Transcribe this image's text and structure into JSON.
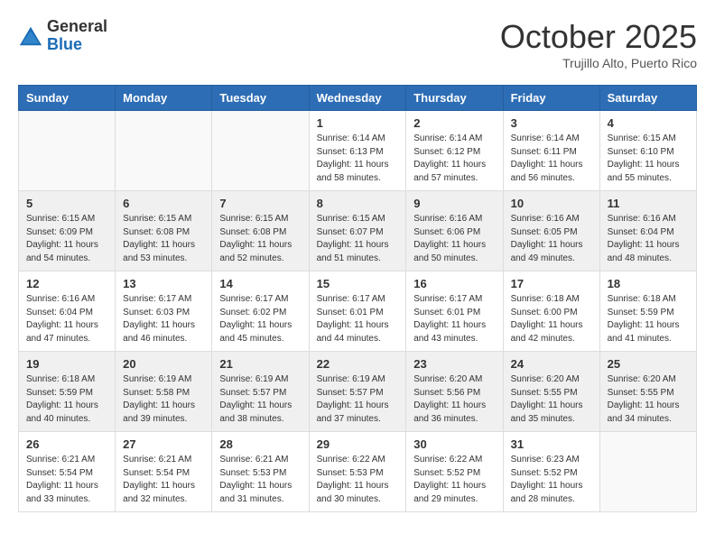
{
  "header": {
    "logo_general": "General",
    "logo_blue": "Blue",
    "month": "October 2025",
    "location": "Trujillo Alto, Puerto Rico"
  },
  "weekdays": [
    "Sunday",
    "Monday",
    "Tuesday",
    "Wednesday",
    "Thursday",
    "Friday",
    "Saturday"
  ],
  "weeks": [
    [
      {
        "day": "",
        "info": ""
      },
      {
        "day": "",
        "info": ""
      },
      {
        "day": "",
        "info": ""
      },
      {
        "day": "1",
        "info": "Sunrise: 6:14 AM\nSunset: 6:13 PM\nDaylight: 11 hours\nand 58 minutes."
      },
      {
        "day": "2",
        "info": "Sunrise: 6:14 AM\nSunset: 6:12 PM\nDaylight: 11 hours\nand 57 minutes."
      },
      {
        "day": "3",
        "info": "Sunrise: 6:14 AM\nSunset: 6:11 PM\nDaylight: 11 hours\nand 56 minutes."
      },
      {
        "day": "4",
        "info": "Sunrise: 6:15 AM\nSunset: 6:10 PM\nDaylight: 11 hours\nand 55 minutes."
      }
    ],
    [
      {
        "day": "5",
        "info": "Sunrise: 6:15 AM\nSunset: 6:09 PM\nDaylight: 11 hours\nand 54 minutes."
      },
      {
        "day": "6",
        "info": "Sunrise: 6:15 AM\nSunset: 6:08 PM\nDaylight: 11 hours\nand 53 minutes."
      },
      {
        "day": "7",
        "info": "Sunrise: 6:15 AM\nSunset: 6:08 PM\nDaylight: 11 hours\nand 52 minutes."
      },
      {
        "day": "8",
        "info": "Sunrise: 6:15 AM\nSunset: 6:07 PM\nDaylight: 11 hours\nand 51 minutes."
      },
      {
        "day": "9",
        "info": "Sunrise: 6:16 AM\nSunset: 6:06 PM\nDaylight: 11 hours\nand 50 minutes."
      },
      {
        "day": "10",
        "info": "Sunrise: 6:16 AM\nSunset: 6:05 PM\nDaylight: 11 hours\nand 49 minutes."
      },
      {
        "day": "11",
        "info": "Sunrise: 6:16 AM\nSunset: 6:04 PM\nDaylight: 11 hours\nand 48 minutes."
      }
    ],
    [
      {
        "day": "12",
        "info": "Sunrise: 6:16 AM\nSunset: 6:04 PM\nDaylight: 11 hours\nand 47 minutes."
      },
      {
        "day": "13",
        "info": "Sunrise: 6:17 AM\nSunset: 6:03 PM\nDaylight: 11 hours\nand 46 minutes."
      },
      {
        "day": "14",
        "info": "Sunrise: 6:17 AM\nSunset: 6:02 PM\nDaylight: 11 hours\nand 45 minutes."
      },
      {
        "day": "15",
        "info": "Sunrise: 6:17 AM\nSunset: 6:01 PM\nDaylight: 11 hours\nand 44 minutes."
      },
      {
        "day": "16",
        "info": "Sunrise: 6:17 AM\nSunset: 6:01 PM\nDaylight: 11 hours\nand 43 minutes."
      },
      {
        "day": "17",
        "info": "Sunrise: 6:18 AM\nSunset: 6:00 PM\nDaylight: 11 hours\nand 42 minutes."
      },
      {
        "day": "18",
        "info": "Sunrise: 6:18 AM\nSunset: 5:59 PM\nDaylight: 11 hours\nand 41 minutes."
      }
    ],
    [
      {
        "day": "19",
        "info": "Sunrise: 6:18 AM\nSunset: 5:59 PM\nDaylight: 11 hours\nand 40 minutes."
      },
      {
        "day": "20",
        "info": "Sunrise: 6:19 AM\nSunset: 5:58 PM\nDaylight: 11 hours\nand 39 minutes."
      },
      {
        "day": "21",
        "info": "Sunrise: 6:19 AM\nSunset: 5:57 PM\nDaylight: 11 hours\nand 38 minutes."
      },
      {
        "day": "22",
        "info": "Sunrise: 6:19 AM\nSunset: 5:57 PM\nDaylight: 11 hours\nand 37 minutes."
      },
      {
        "day": "23",
        "info": "Sunrise: 6:20 AM\nSunset: 5:56 PM\nDaylight: 11 hours\nand 36 minutes."
      },
      {
        "day": "24",
        "info": "Sunrise: 6:20 AM\nSunset: 5:55 PM\nDaylight: 11 hours\nand 35 minutes."
      },
      {
        "day": "25",
        "info": "Sunrise: 6:20 AM\nSunset: 5:55 PM\nDaylight: 11 hours\nand 34 minutes."
      }
    ],
    [
      {
        "day": "26",
        "info": "Sunrise: 6:21 AM\nSunset: 5:54 PM\nDaylight: 11 hours\nand 33 minutes."
      },
      {
        "day": "27",
        "info": "Sunrise: 6:21 AM\nSunset: 5:54 PM\nDaylight: 11 hours\nand 32 minutes."
      },
      {
        "day": "28",
        "info": "Sunrise: 6:21 AM\nSunset: 5:53 PM\nDaylight: 11 hours\nand 31 minutes."
      },
      {
        "day": "29",
        "info": "Sunrise: 6:22 AM\nSunset: 5:53 PM\nDaylight: 11 hours\nand 30 minutes."
      },
      {
        "day": "30",
        "info": "Sunrise: 6:22 AM\nSunset: 5:52 PM\nDaylight: 11 hours\nand 29 minutes."
      },
      {
        "day": "31",
        "info": "Sunrise: 6:23 AM\nSunset: 5:52 PM\nDaylight: 11 hours\nand 28 minutes."
      },
      {
        "day": "",
        "info": ""
      }
    ]
  ]
}
